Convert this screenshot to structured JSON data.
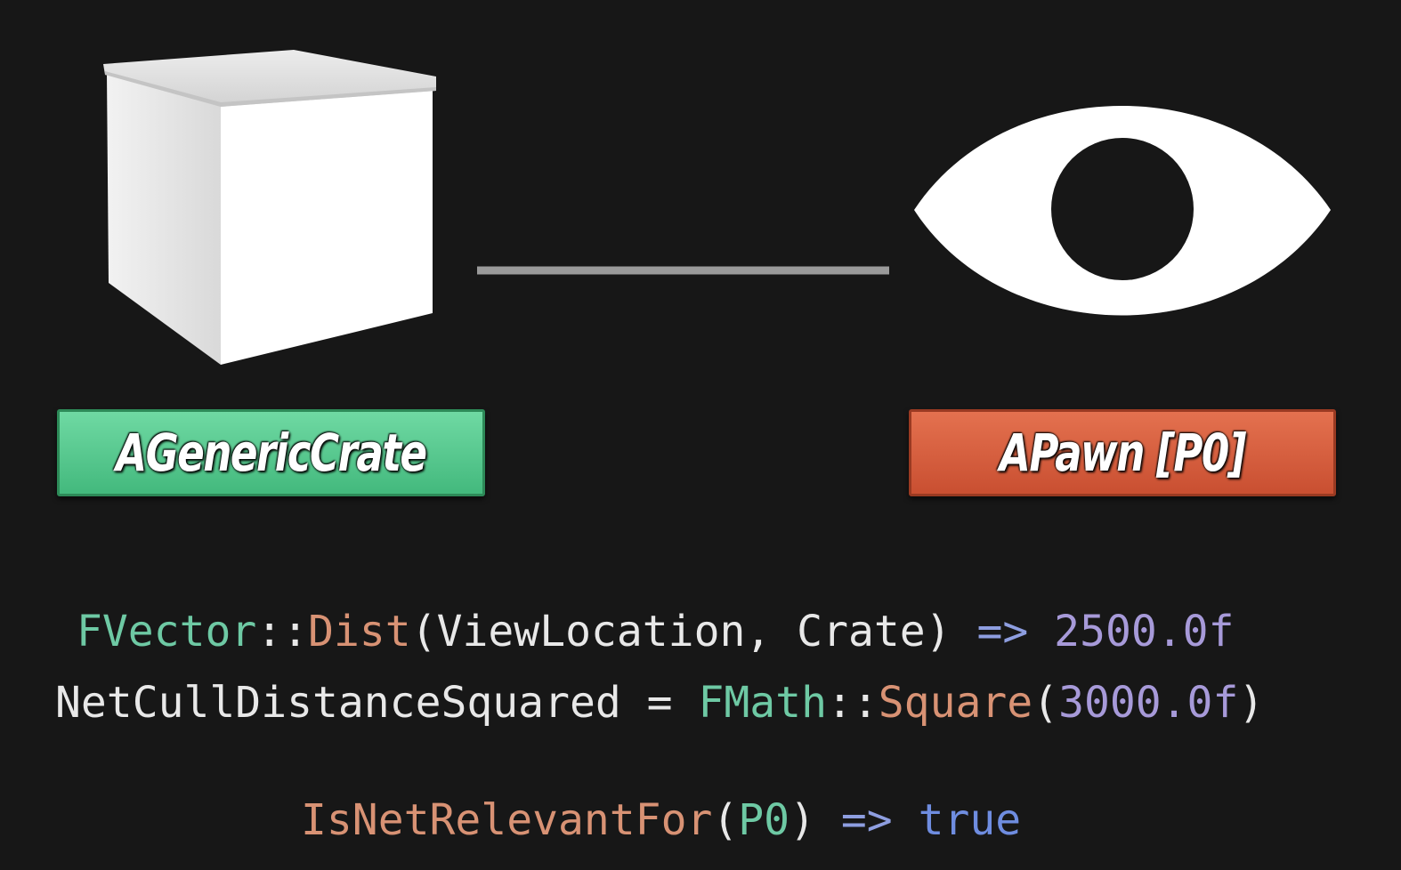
{
  "labels": {
    "crate": "AGenericCrate",
    "pawn": "APawn [P0]"
  },
  "code": {
    "line1": {
      "type": "FVector",
      "sep1": "::",
      "func": "Dist",
      "open": "(",
      "args": "ViewLocation, Crate",
      "close": ")",
      "arrow": " => ",
      "value": "2500.0f"
    },
    "line2": {
      "ident": "NetCullDistanceSquared",
      "eq": " = ",
      "type": "FMath",
      "sep1": "::",
      "func": "Square",
      "open": "(",
      "value": "3000.0f",
      "close": ")"
    },
    "line3": {
      "func": "IsNetRelevantFor",
      "open": "(",
      "arg": "P0",
      "close": ")",
      "arrow": " => ",
      "value": "true"
    }
  },
  "colors": {
    "background": "#171717",
    "crate_label": "#4fc487",
    "pawn_label": "#d65c3b",
    "type": "#6ec9a4",
    "func": "#d89274",
    "number": "#a79ad9",
    "bool": "#6f8de0"
  },
  "icons": {
    "crate": "cube-icon",
    "viewer": "eye-icon"
  }
}
